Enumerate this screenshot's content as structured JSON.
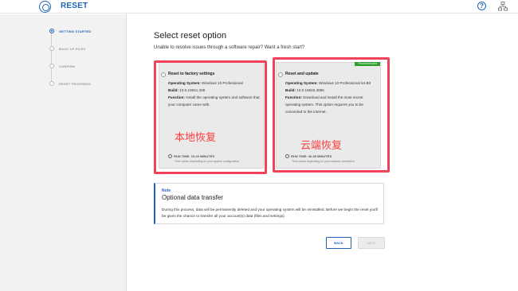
{
  "app": {
    "title": "RESET"
  },
  "steps": [
    {
      "label": "GETTING STARTED",
      "active": true
    },
    {
      "label": "BACK UP FILES",
      "active": false
    },
    {
      "label": "CONFIRM",
      "active": false
    },
    {
      "label": "RESET PROGRESS",
      "active": false
    }
  ],
  "main": {
    "heading": "Select reset option",
    "subheading": "Unable to resolve issues through a software repair? Want a fresh start?"
  },
  "options": [
    {
      "title": "Reset to factory settings",
      "os_label": "Operating System:",
      "os_value": "Windows 10 Professional",
      "build_label": "Build:",
      "build_value": "10.0.19041.208",
      "function_label": "Function:",
      "function_value": "Install the operating system and software that your computer came with.",
      "annotation": "本地恢复",
      "run_time": "RUN TIME: 15-20 MINUTES",
      "varies": "Time varies depending on your system configuration"
    },
    {
      "badge": "Recommended",
      "title": "Reset and update",
      "os_label": "Operating System:",
      "os_value": "Windows 10 Professional 64-Bit",
      "build_label": "Build:",
      "build_value": "10.0.19045.3086",
      "function_label": "Function:",
      "function_value": "Download and install the most recent operating system. This option requires you to be connected to the internet.",
      "annotation": "云端恢复",
      "run_time": "RUN TIME: 40-45 MINUTES",
      "varies": "Time varies depending on your network connection"
    }
  ],
  "note": {
    "label": "Note",
    "title": "Optional data transfer",
    "text": "During this process, data will be permanently deleted and your operating system will be reinstalled. Before we begin the reset you'll be given the chance to transfer all your account(s) data (files and settings)."
  },
  "buttons": {
    "back": "BACK",
    "next": "NEXT"
  },
  "colors": {
    "accent": "#1f63b8",
    "highlight": "#f0435a",
    "annotation": "#ff3b3b",
    "badge": "#2a9d2a"
  },
  "icons": {
    "logo": "dell-logo-icon",
    "help": "help-icon",
    "network": "network-icon",
    "clock": "clock-icon"
  }
}
